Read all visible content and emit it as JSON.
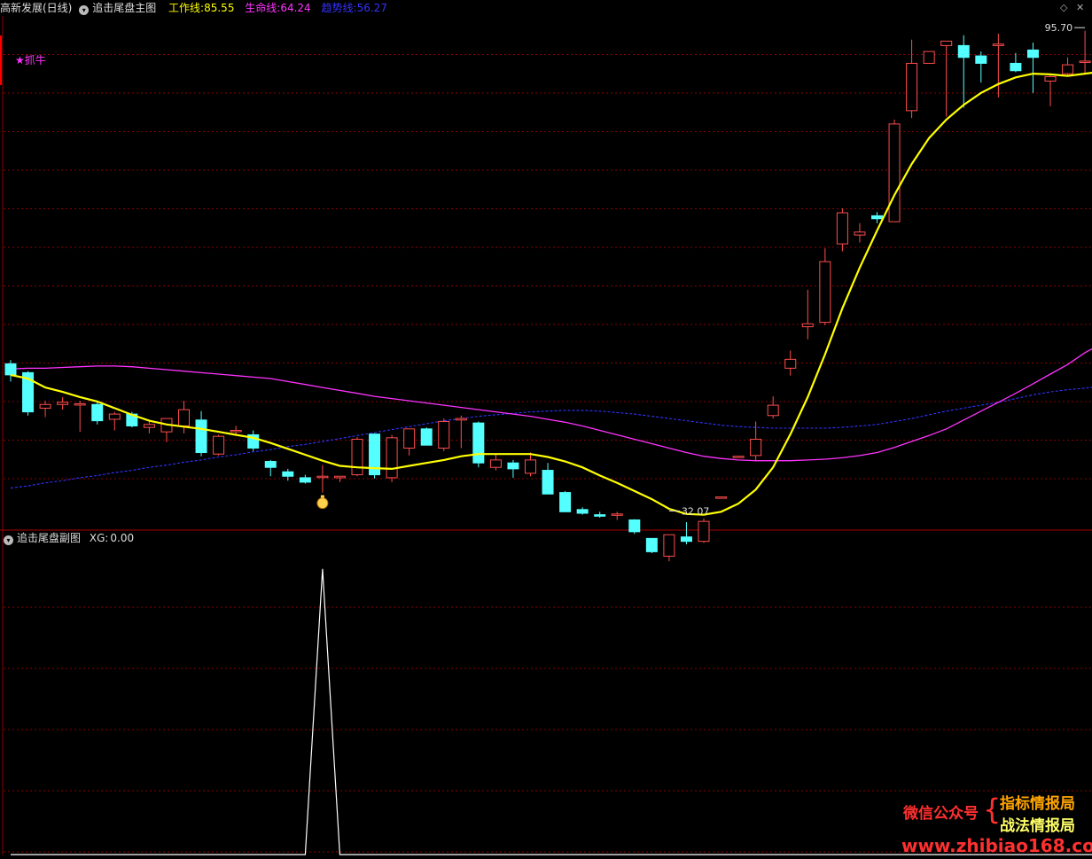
{
  "header": {
    "stock": "高新发展(日线)",
    "main_indicator": "追击尾盘主图",
    "lines": [
      {
        "label": "工作线:",
        "value": "85.55",
        "color": "#ffff00"
      },
      {
        "label": "生命线:",
        "value": "64.24",
        "color": "#ff33ff"
      },
      {
        "label": "趋势线:",
        "value": "56.27",
        "color": "#3333ff"
      }
    ]
  },
  "sub_header": {
    "name": "追击尾盘副图",
    "label": "XG:",
    "value": "0.00"
  },
  "signal_label": "★抓牛",
  "colors": {
    "up": "#ff4d4d",
    "down": "#54ffff",
    "work": "#ffff00",
    "life": "#ff33ff",
    "trend": "#3333ff",
    "grid": "#8b0000",
    "xg": "#ffffff"
  },
  "chart_data": [
    {
      "type": "candlestick",
      "title": "追击尾盘主图",
      "ylim": [
        29,
        98
      ],
      "annotations": [
        {
          "text": "95.70",
          "index": 62,
          "value": 95.7
        },
        {
          "text": "32.07",
          "index": 38,
          "value": 32.07
        }
      ],
      "marker": {
        "icon": "money-bag-icon",
        "index": 18
      },
      "ohlc": [
        [
          51.0,
          51.5,
          48.6,
          49.5
        ],
        [
          49.8,
          50.0,
          44.0,
          44.5
        ],
        [
          45.0,
          46.0,
          43.8,
          45.5
        ],
        [
          45.5,
          46.5,
          44.8,
          45.8
        ],
        [
          45.6,
          46.0,
          41.8,
          45.6
        ],
        [
          45.5,
          45.8,
          42.8,
          43.3
        ],
        [
          43.5,
          44.5,
          42.0,
          44.2
        ],
        [
          44.2,
          44.5,
          42.4,
          42.6
        ],
        [
          42.4,
          43.2,
          41.6,
          42.8
        ],
        [
          41.8,
          42.0,
          40.4,
          43.6
        ],
        [
          42.6,
          46.0,
          41.6,
          44.8
        ],
        [
          43.4,
          44.6,
          38.5,
          39.0
        ],
        [
          38.8,
          41.4,
          38.6,
          41.2
        ],
        [
          42.0,
          42.6,
          41.5,
          42.0
        ],
        [
          41.4,
          42.0,
          39.2,
          39.6
        ],
        [
          37.8,
          38.0,
          35.8,
          37.0
        ],
        [
          36.4,
          36.8,
          35.2,
          35.8
        ],
        [
          35.6,
          36.0,
          34.8,
          35.0
        ],
        [
          35.8,
          37.3,
          33.6,
          35.8
        ],
        [
          35.6,
          35.8,
          35.0,
          35.8
        ],
        [
          36.0,
          41.1,
          35.8,
          40.8
        ],
        [
          41.5,
          41.6,
          35.5,
          36.0
        ],
        [
          35.6,
          41.4,
          35.0,
          41.0
        ],
        [
          39.6,
          42.2,
          38.6,
          42.2
        ],
        [
          42.2,
          42.4,
          40.0,
          40.0
        ],
        [
          39.6,
          43.6,
          39.2,
          43.2
        ],
        [
          43.4,
          44.0,
          39.6,
          43.6
        ],
        [
          43.0,
          43.2,
          37.0,
          37.6
        ],
        [
          37.0,
          38.8,
          36.6,
          38.0
        ],
        [
          37.6,
          38.0,
          35.6,
          36.8
        ],
        [
          36.2,
          39.0,
          35.8,
          38.0
        ],
        [
          36.6,
          37.6,
          33.4,
          33.4
        ],
        [
          33.6,
          33.8,
          31.0,
          31.0
        ],
        [
          31.3,
          31.6,
          30.6,
          30.8
        ],
        [
          30.6,
          31.0,
          30.2,
          30.4
        ],
        [
          30.6,
          31.0,
          29.9,
          30.7
        ],
        [
          29.9,
          30.0,
          28.0,
          28.3
        ],
        [
          27.4,
          27.4,
          25.4,
          25.6
        ],
        [
          25.0,
          27.9,
          24.3,
          27.9
        ],
        [
          27.6,
          29.6,
          26.6,
          27.0
        ],
        [
          27.0,
          30.1,
          26.8,
          29.7
        ],
        [
          33.0,
          33.0,
          33.0,
          33.0
        ],
        [
          38.5,
          38.5,
          38.5,
          38.5
        ],
        [
          38.6,
          43.2,
          37.8,
          40.8
        ],
        [
          44.0,
          46.6,
          43.6,
          45.4
        ],
        [
          50.4,
          52.8,
          49.4,
          51.6
        ],
        [
          56.0,
          61.0,
          54.3,
          56.4
        ],
        [
          56.6,
          66.6,
          56.2,
          64.8
        ],
        [
          67.2,
          72.0,
          66.2,
          71.4
        ],
        [
          68.4,
          70.0,
          67.4,
          68.8
        ],
        [
          71.0,
          71.5,
          70.0,
          70.6
        ],
        [
          70.2,
          84.0,
          71.8,
          83.4
        ],
        [
          85.2,
          94.8,
          84.2,
          91.6
        ],
        [
          91.6,
          93.2,
          91.8,
          93.2
        ],
        [
          94.0,
          94.6,
          84.4,
          94.6
        ],
        [
          94.0,
          95.4,
          85.6,
          92.4
        ],
        [
          92.6,
          93.2,
          89.0,
          91.6
        ],
        [
          94.0,
          95.6,
          87.0,
          94.2
        ],
        [
          91.6,
          93.0,
          90.4,
          90.6
        ],
        [
          93.4,
          94.4,
          87.6,
          92.4
        ],
        [
          89.2,
          90.0,
          85.8,
          89.8
        ],
        [
          90.2,
          92.4,
          90.0,
          91.4
        ],
        [
          91.8,
          96.0,
          90.2,
          91.9
        ],
        [
          90.8,
          98.0,
          90.4,
          95.0
        ]
      ],
      "series": [
        {
          "values": [
            49.5,
            49.0,
            47.8,
            47.2,
            46.5,
            45.9,
            45.0,
            44.1,
            43.3,
            42.8,
            42.5,
            42.2,
            41.8,
            41.4,
            41.0,
            40.3,
            39.5,
            38.7,
            37.9,
            37.2,
            37.0,
            36.9,
            36.8,
            37.2,
            37.6,
            38.0,
            38.5,
            38.8,
            38.8,
            38.8,
            38.8,
            38.4,
            37.8,
            37.0,
            35.9,
            34.9,
            33.8,
            32.7,
            31.4,
            30.7,
            30.6,
            31.0,
            32.1,
            34.0,
            37.0,
            41.5,
            46.5,
            52.3,
            58.5,
            64.0,
            69.0,
            73.8,
            78.0,
            81.5,
            84.0,
            86.0,
            87.6,
            88.8,
            89.7,
            90.2,
            90.1,
            89.9,
            90.2,
            90.5
          ]
        },
        {
          "values": [
            50.3,
            50.4,
            50.4,
            50.5,
            50.6,
            50.7,
            50.7,
            50.6,
            50.4,
            50.2,
            50.0,
            49.8,
            49.6,
            49.4,
            49.2,
            49.0,
            48.6,
            48.2,
            47.8,
            47.4,
            47.0,
            46.6,
            46.3,
            46.0,
            45.7,
            45.4,
            45.1,
            44.8,
            44.5,
            44.2,
            43.9,
            43.5,
            43.1,
            42.6,
            42.0,
            41.4,
            40.8,
            40.2,
            39.6,
            39.0,
            38.5,
            38.2,
            38.0,
            37.9,
            37.9,
            37.9,
            38.0,
            38.1,
            38.3,
            38.6,
            39.0,
            39.7,
            40.5,
            41.3,
            42.2,
            43.4,
            44.6,
            45.8,
            47.0,
            48.3,
            49.6,
            50.9,
            52.5,
            53.8
          ]
        },
        {
          "values": [
            34.2,
            34.5,
            34.9,
            35.2,
            35.6,
            35.9,
            36.3,
            36.6,
            37.0,
            37.3,
            37.7,
            38.0,
            38.4,
            38.7,
            39.1,
            39.4,
            39.8,
            40.1,
            40.5,
            40.9,
            41.3,
            41.7,
            42.1,
            42.5,
            42.9,
            43.3,
            43.6,
            43.9,
            44.1,
            44.3,
            44.5,
            44.6,
            44.7,
            44.7,
            44.6,
            44.4,
            44.2,
            43.9,
            43.6,
            43.3,
            43.0,
            42.7,
            42.5,
            42.4,
            42.3,
            42.3,
            42.3,
            42.3,
            42.4,
            42.6,
            42.8,
            43.2,
            43.6,
            44.1,
            44.6,
            45.0,
            45.4,
            45.8,
            46.3,
            46.8,
            47.2,
            47.5,
            47.7,
            48.0
          ]
        }
      ]
    },
    {
      "type": "line",
      "title": "追击尾盘副图",
      "ylim": [
        0,
        1.08
      ],
      "series": [
        {
          "name": "XG",
          "values": [
            0,
            0,
            0,
            0,
            0,
            0,
            0,
            0,
            0,
            0,
            0,
            0,
            0,
            0,
            0,
            0,
            0,
            0,
            1,
            0,
            0,
            0,
            0,
            0,
            0,
            0,
            0,
            0,
            0,
            0,
            0,
            0,
            0,
            0,
            0,
            0,
            0,
            0,
            0,
            0,
            0,
            0,
            0,
            0,
            0,
            0,
            0,
            0,
            0,
            0,
            0,
            0,
            0,
            0,
            0,
            0,
            0,
            0,
            0,
            0,
            0,
            0,
            0,
            0
          ]
        }
      ]
    }
  ],
  "watermark": {
    "wechat": "微信公众号",
    "brace": "{",
    "name1": "指标情报局",
    "name2": "战法情报局",
    "url": "www.zhibiao168.com"
  }
}
